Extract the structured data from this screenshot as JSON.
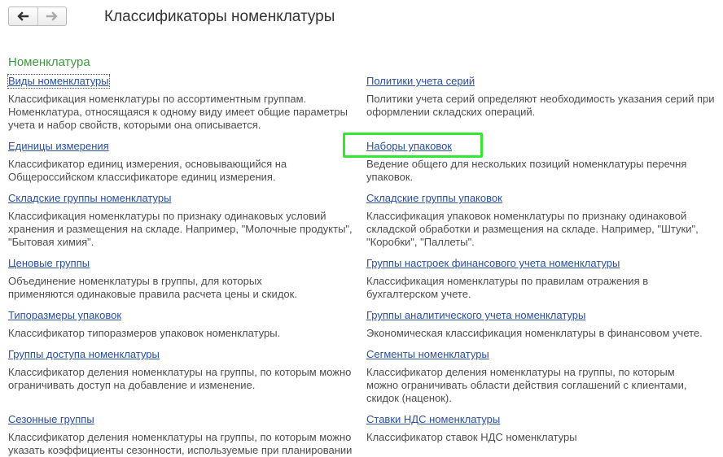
{
  "header": {
    "title": "Классификаторы номенклатуры",
    "back_icon": "arrow-left-icon",
    "forward_icon": "arrow-right-icon"
  },
  "section": {
    "title": "Номенклатура"
  },
  "left_items": [
    {
      "link": "Виды номенклатуры",
      "desc": [
        "Классификация номенклатуры по ассортиментным группам.",
        "Номенклатура, относящаяся к одному виду имеет общие параметры",
        "учета и набор свойств, которыми она описывается."
      ]
    },
    {
      "link": "Единицы измерения",
      "desc": [
        "Классификатор единиц измерения, основывающийся на",
        "Общероссийском классификаторе единиц измерения."
      ]
    },
    {
      "link": "Складские группы номенклатуры",
      "desc": [
        "Классификация номенклатуры по признаку одинаковых условий",
        "хранения и размещения на складе. Например, \"Молочные продукты\",",
        "\"Бытовая химия\"."
      ]
    },
    {
      "link": "Ценовые группы",
      "desc": [
        "Объединение номенклатуры в группы, для которых",
        "применяются одинаковые правила расчета цены и скидок."
      ]
    },
    {
      "link": "Типоразмеры упаковок",
      "desc": [
        "Классификатор типоразмеров упаковок номенклатуры."
      ]
    },
    {
      "link": "Группы доступа номенклатуры",
      "desc": [
        "Классификатор деления номенклатуры на группы, по которым можно",
        "ограничивать доступ на добавление и изменение."
      ]
    },
    {
      "link": "Сезонные группы",
      "desc": [
        "Классификатор деления номенклатуры на группы, по которым можно",
        "указать коэффициенты сезонности, используемые при планировании"
      ]
    }
  ],
  "right_items": [
    {
      "link": "Политики учета серий",
      "desc": [
        "Политики учета серий определяют необходимость указания серий при",
        "оформлении складских операций."
      ]
    },
    {
      "link": "Наборы упаковок",
      "desc": [
        "Ведение общего для нескольких позиций номенклатуры перечня",
        "упаковок."
      ]
    },
    {
      "link": "Складские группы упаковок",
      "desc": [
        "Классификация упаковок номенклатуры по признаку одинаковой",
        "складской обработки и размещения на складе. Например, \"Штуки\",",
        "\"Коробки\", \"Паллеты\"."
      ]
    },
    {
      "link": "Группы настроек финансового учета номенклатуры",
      "desc": [
        "Классификация номенклатуры по правилам отражения в",
        "бухгалтерском учете."
      ]
    },
    {
      "link": "Группы аналитического учета номенклатуры",
      "desc": [
        "Экономическая классификация номенклатуры в финансовом учете."
      ]
    },
    {
      "link": "Сегменты номенклатуры",
      "desc": [
        "Классификатор деления номенклатуры на группы, по которым",
        "можно ограничивать области действия соглашений с клиентами,",
        "скидок (наценок)."
      ]
    },
    {
      "link": "Ставки НДС номенклатуры",
      "desc": [
        "Классификатор ставок НДС номенклатуры"
      ]
    }
  ],
  "colors": {
    "link": "#2a4f9b",
    "section": "#3c9a3c",
    "highlight": "#35e635",
    "text": "#4d4d4d"
  }
}
